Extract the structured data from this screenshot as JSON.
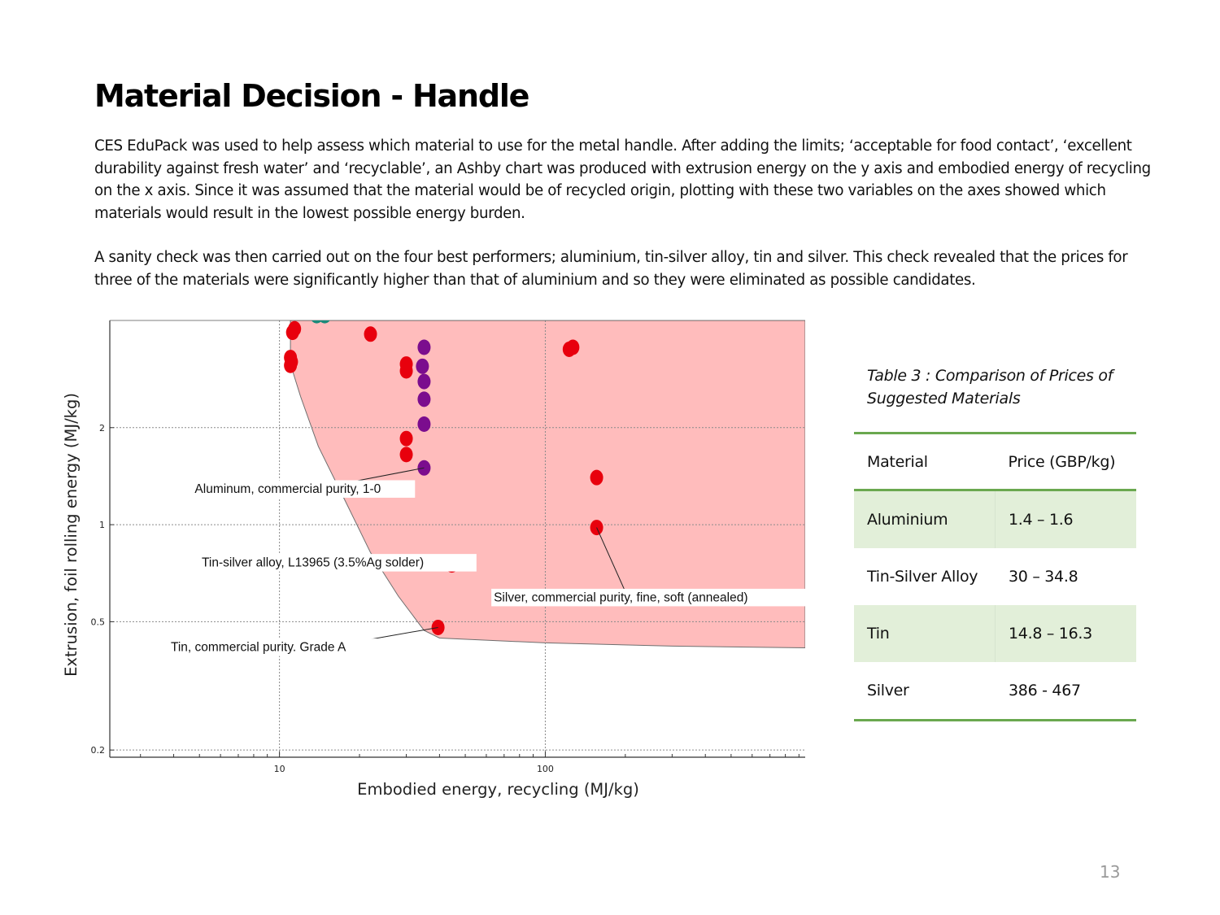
{
  "slide": {
    "title": "Material Decision - Handle",
    "paragraphs": [
      "CES EduPack was used to help assess which material to use for the metal handle. After adding the limits; ‘acceptable for food contact’, ‘excellent durability against fresh water’ and ‘recyclable’, an Ashby chart was produced with extrusion energy on the y axis and embodied energy of recycling on the x axis. Since it was assumed that the material would be of recycled origin, plotting with these two variables on the axes showed which materials would result in the lowest possible energy burden.",
      "A sanity check was then carried out on the four best performers; aluminium, tin-silver alloy, tin and silver. This check revealed that the prices for three of the materials were significantly higher than that of aluminium and so they were eliminated as possible candidates."
    ],
    "page_number": "13"
  },
  "table": {
    "caption": "Table 3 : Comparison of Prices of Suggested Materials",
    "headers": [
      "Material",
      "Price (GBP/kg)"
    ],
    "rows": [
      [
        "Aluminium",
        "1.4 – 1.6"
      ],
      [
        "Tin-Silver Alloy",
        "30 – 34.8"
      ],
      [
        "Tin",
        "14.8 – 16.3"
      ],
      [
        "Silver",
        "386 - 467"
      ]
    ],
    "colors": {
      "rule": "#6aa84f",
      "shade": "#e2efd9"
    }
  },
  "chart_data": {
    "type": "scatter",
    "xlabel": "Embodied energy, recycling (MJ/kg)",
    "ylabel": "Extrusion, foil rolling energy (MJ/kg)",
    "x_scale": "log",
    "y_scale": "log",
    "xlim": [
      2.3,
      950
    ],
    "ylim": [
      0.19,
      4.3
    ],
    "x_ticks": [
      {
        "value": 10,
        "label": "10"
      },
      {
        "value": 100,
        "label": "100"
      }
    ],
    "y_ticks": [
      {
        "value": 0.2,
        "label": "0.2"
      },
      {
        "value": 0.5,
        "label": "0.5"
      },
      {
        "value": 1,
        "label": "1"
      },
      {
        "value": 2,
        "label": "2"
      }
    ],
    "grid": true,
    "region_color": "#ffbcbc",
    "region_outline": [
      [
        11,
        4.3
      ],
      [
        11,
        3.15
      ],
      [
        12,
        2.5
      ],
      [
        14,
        1.75
      ],
      [
        18,
        1.15
      ],
      [
        22,
        0.82
      ],
      [
        28,
        0.6
      ],
      [
        35,
        0.47
      ],
      [
        40,
        0.445
      ],
      [
        100,
        0.43
      ],
      [
        300,
        0.42
      ],
      [
        950,
        0.415
      ],
      [
        950,
        4.3
      ]
    ],
    "series": [
      {
        "color": "#e8000d",
        "points": [
          [
            11.2,
            3.95
          ],
          [
            11.4,
            4.05
          ],
          [
            11,
            3.3
          ],
          [
            11,
            3.12
          ],
          [
            11.1,
            3.2
          ],
          [
            22,
            3.9
          ],
          [
            30,
            3.15
          ],
          [
            30,
            3.0
          ],
          [
            30,
            1.85
          ],
          [
            30,
            1.65
          ],
          [
            123,
            3.5
          ],
          [
            127,
            3.55
          ],
          [
            156,
            1.4
          ],
          [
            156,
            0.98
          ],
          [
            44.5,
            0.75
          ],
          [
            39.5,
            0.48
          ]
        ]
      },
      {
        "color": "#7b0d8e",
        "points": [
          [
            35,
            3.55
          ],
          [
            34.5,
            3.1
          ],
          [
            35,
            2.78
          ],
          [
            35,
            2.45
          ],
          [
            35,
            2.05
          ],
          [
            35,
            1.5
          ]
        ]
      },
      {
        "color": "#1a8a7a",
        "points": [
          [
            13.8,
            4.45
          ],
          [
            14.8,
            4.45
          ]
        ]
      }
    ],
    "annotations": [
      {
        "text": "Aluminum, commercial purity, 1-0",
        "point": [
          35,
          1.5
        ],
        "label_at": [
          4.8,
          1.27
        ],
        "anchor": "start",
        "line_from": [
          12.2,
          1.27
        ]
      },
      {
        "text": "Tin-silver alloy, L13965 (3.5%Ag solder)",
        "point": [
          44.5,
          0.75
        ],
        "label_at": [
          5.1,
          0.75
        ],
        "anchor": "start",
        "line_from": [
          39.8,
          0.75
        ]
      },
      {
        "text": "Silver, commercial purity, fine, soft (annealed)",
        "point": [
          156,
          0.98
        ],
        "label_at": [
          64,
          0.585
        ],
        "anchor": "start",
        "line_from": [
          200,
          0.62
        ]
      },
      {
        "text": "Tin, commercial purity. Grade A",
        "point": [
          39.5,
          0.48
        ],
        "label_at": [
          3.9,
          0.41
        ],
        "anchor": "start",
        "line_from": [
          18.5,
          0.43
        ]
      }
    ]
  }
}
